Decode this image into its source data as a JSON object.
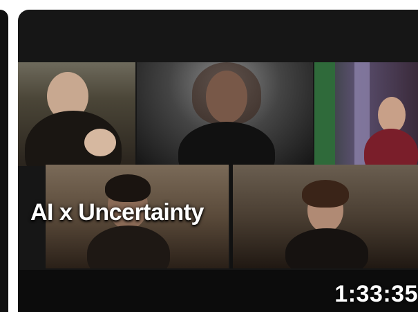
{
  "thumbnail": {
    "overlay_title": "AI x Uncertainty",
    "duration": "1:33:35"
  }
}
